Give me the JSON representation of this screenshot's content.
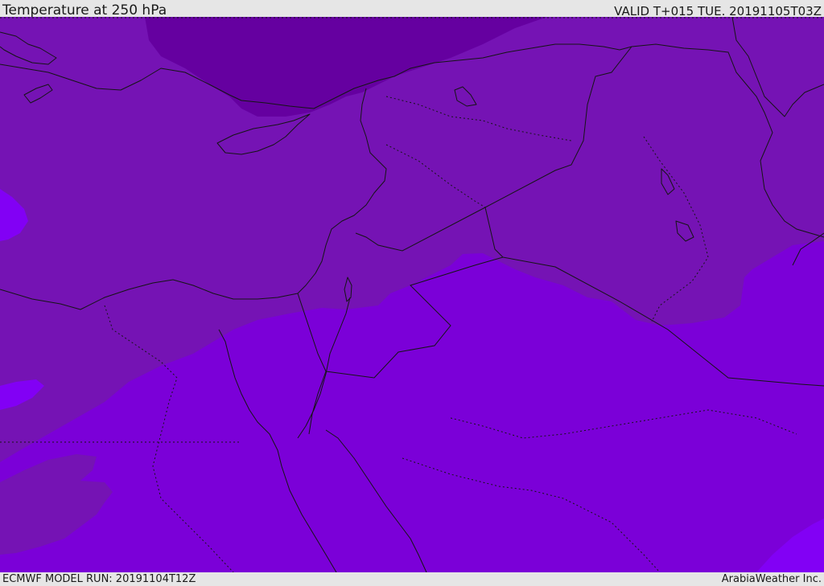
{
  "header": {
    "title": "Temperature at 250 hPa",
    "valid": "VALID T+015 TUE. 20191105T03Z"
  },
  "footer": {
    "model_run": "ECMWF MODEL RUN: 20191104T12Z",
    "credit": "ArabiaWeather Inc."
  },
  "map": {
    "parameter": "temperature",
    "level": "250 hPa",
    "colors": {
      "coldest": "#6500a0",
      "cold": "#7513b4",
      "mild": "#7b00d8",
      "warm": "#8200f5"
    }
  }
}
